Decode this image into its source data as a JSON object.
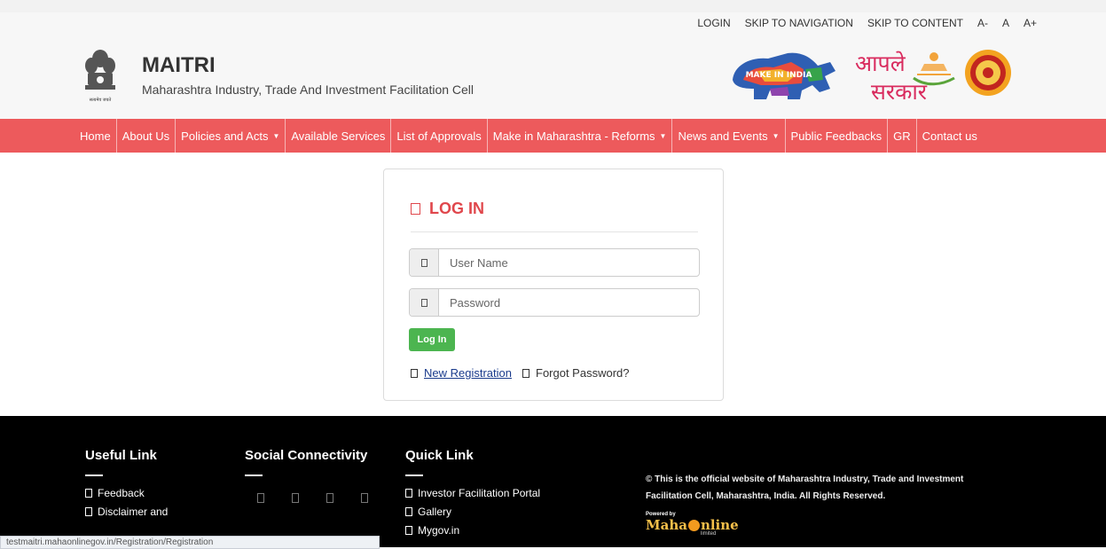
{
  "colors": {
    "accent": "#ed5a5c",
    "heading": "#e0474c",
    "button": "#4cb550",
    "footer_bg": "#000000"
  },
  "utility_links": [
    "LOGIN",
    "SKIP TO NAVIGATION",
    "SKIP TO CONTENT",
    "A-",
    "A",
    "A+"
  ],
  "header": {
    "title": "MAITRI",
    "subtitle": "Maharashtra Industry, Trade And Investment Facilitation Cell",
    "emblem_caption": "सत्यमेव जयते",
    "make_in_india_text": "MAKE IN INDIA",
    "aaple_line1": "आपले",
    "aaple_line2": "सरकार"
  },
  "nav": {
    "items": [
      {
        "label": "Home",
        "dropdown": false
      },
      {
        "label": "About Us",
        "dropdown": false
      },
      {
        "label": "Policies and Acts",
        "dropdown": true
      },
      {
        "label": "Available Services",
        "dropdown": false
      },
      {
        "label": "List of Approvals",
        "dropdown": false
      },
      {
        "label": "Make in Maharashtra - Reforms",
        "dropdown": true
      },
      {
        "label": "News and Events",
        "dropdown": true
      },
      {
        "label": "Public Feedbacks",
        "dropdown": false
      },
      {
        "label": "GR",
        "dropdown": false
      },
      {
        "label": "Contact us",
        "dropdown": false
      }
    ]
  },
  "login": {
    "title": "LOG IN",
    "username_placeholder": "User Name",
    "password_placeholder": "Password",
    "button_label": "Log In",
    "new_registration": "New Registration",
    "forgot_password": "Forgot Password?"
  },
  "footer": {
    "useful_title": "Useful Link",
    "useful_links": [
      "Feedback",
      "Disclaimer and"
    ],
    "social_title": "Social Connectivity",
    "quick_title": "Quick Link",
    "quick_links": [
      "Investor Facilitation Portal",
      "Gallery",
      "Mygov.in"
    ],
    "copyright": "© This is the official website of Maharashtra Industry, Trade and Investment Facilitation Cell, Maharashtra, India. All Rights Reserved.",
    "powered_by": "Powered by",
    "maha_left": "Maha",
    "maha_right": "nline",
    "limited": "limited"
  },
  "status_url": "testmaitri.mahaonlinegov.in/Registration/Registration"
}
